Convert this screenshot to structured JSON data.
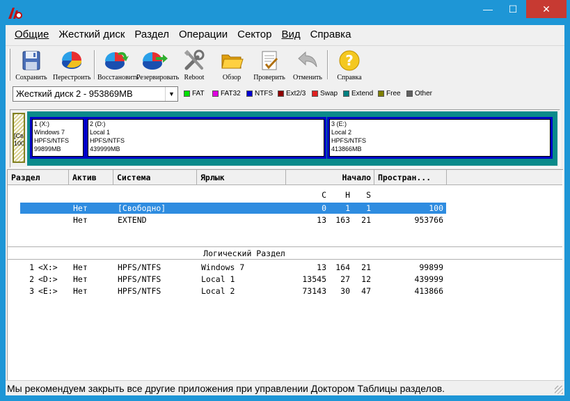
{
  "window": {
    "min_glyph": "—",
    "max_glyph": "☐",
    "close_glyph": "✕"
  },
  "menu": [
    "Общие",
    "Жесткий диск",
    "Раздел",
    "Операции",
    "Сектор",
    "Вид",
    "Справка"
  ],
  "toolbar": [
    {
      "label": "Сохранить",
      "icon": "floppy-disk-icon"
    },
    {
      "label": "Перестроить",
      "icon": "pie-chart-icon"
    },
    {
      "label": "Восстановить",
      "icon": "restore-pie-icon"
    },
    {
      "label": "Резервировать",
      "icon": "backup-pie-icon"
    },
    {
      "label": "Reboot",
      "icon": "tools-icon"
    },
    {
      "label": "Обзор",
      "icon": "folder-icon"
    },
    {
      "label": "Проверить",
      "icon": "check-document-icon"
    },
    {
      "label": "Отменить",
      "icon": "undo-arrow-icon"
    },
    {
      "label": "Справка",
      "icon": "help-icon"
    }
  ],
  "disk_selector": {
    "value": "Жесткий диск 2 - 953869MB"
  },
  "legend": [
    {
      "label": "FAT",
      "color": "#00e000"
    },
    {
      "label": "FAT32",
      "color": "#e000e0"
    },
    {
      "label": "NTFS",
      "color": "#0000d0"
    },
    {
      "label": "Ext2/3",
      "color": "#900000"
    },
    {
      "label": "Swap",
      "color": "#e02020"
    },
    {
      "label": "Extend",
      "color": "#008080"
    },
    {
      "label": "Free",
      "color": "#808000"
    },
    {
      "label": "Other",
      "color": "#606060"
    }
  ],
  "diskmap": {
    "free": {
      "line1": "[Св",
      "line2": "100"
    },
    "partitions": [
      {
        "line1": "1 (X:)",
        "line2": "Windows 7",
        "line3": "HPFS/NTFS",
        "line4": "99899MB"
      },
      {
        "line1": "2 (D:)",
        "line2": "Local 1",
        "line3": "HPFS/NTFS",
        "line4": "439999MB"
      },
      {
        "line1": "3 (E:)",
        "line2": "Local 2",
        "line3": "HPFS/NTFS",
        "line4": "413866MB"
      }
    ]
  },
  "table": {
    "headers": {
      "partition": "Раздел",
      "active": "Актив",
      "system": "Система",
      "label": "Ярлык",
      "start": "Начало",
      "size": "Простран..."
    },
    "chs": {
      "c": "C",
      "h": "H",
      "s": "S"
    },
    "primary_rows": [
      {
        "active": "Нет",
        "system": "[Свободно]",
        "c": "0",
        "h": "1",
        "s": "1",
        "size": "100"
      },
      {
        "active": "Нет",
        "system": "EXTEND",
        "c": "13",
        "h": "163",
        "s": "21",
        "size": "953766"
      }
    ],
    "logical_title": "Логический Раздел",
    "logical_rows": [
      {
        "num": "1",
        "drive": "<X:>",
        "active": "Нет",
        "system": "HPFS/NTFS",
        "label": "Windows 7",
        "c": "13",
        "h": "164",
        "s": "21",
        "size": "99899"
      },
      {
        "num": "2",
        "drive": "<D:>",
        "active": "Нет",
        "system": "HPFS/NTFS",
        "label": "Local 1",
        "c": "13545",
        "h": "27",
        "s": "12",
        "size": "439999"
      },
      {
        "num": "3",
        "drive": "<E:>",
        "active": "Нет",
        "system": "HPFS/NTFS",
        "label": "Local 2",
        "c": "73143",
        "h": "30",
        "s": "47",
        "size": "413866"
      }
    ]
  },
  "status": "Мы рекомендуем закрыть все другие приложения при управлении Доктором Таблицы разделов."
}
